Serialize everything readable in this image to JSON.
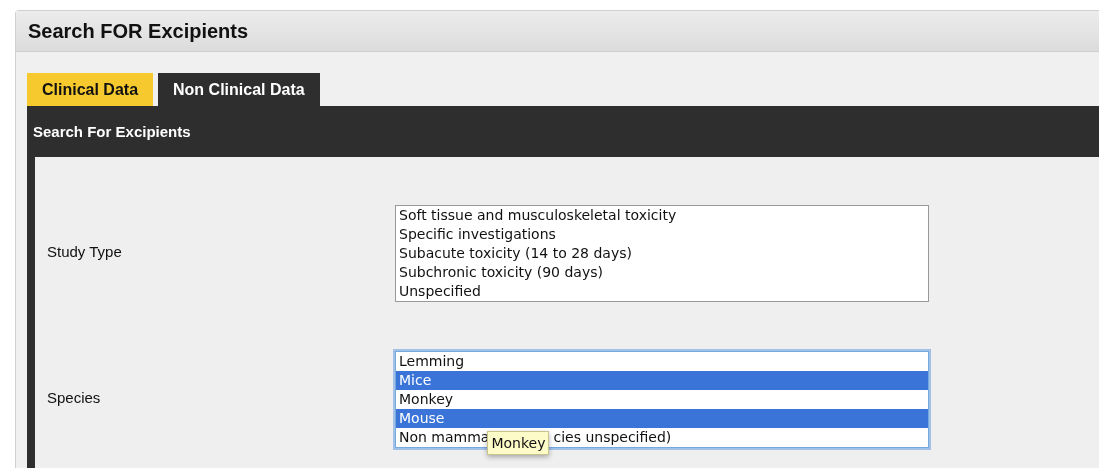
{
  "page_title": "Search FOR Excipients",
  "tabs": [
    {
      "label": "Clinical Data",
      "selected": false
    },
    {
      "label": "Non Clinical Data",
      "selected": true
    }
  ],
  "section_title": "Search For Excipients",
  "fields": [
    {
      "label": "Study Type",
      "focused": false,
      "options": [
        {
          "label": "Soft tissue and musculoskeletal toxicity",
          "selected": false
        },
        {
          "label": "Specific investigations",
          "selected": false
        },
        {
          "label": "Subacute toxicity (14 to 28 days)",
          "selected": false
        },
        {
          "label": "Subchronic toxicity (90 days)",
          "selected": false
        },
        {
          "label": "Unspecified",
          "selected": false
        }
      ]
    },
    {
      "label": "Species",
      "focused": true,
      "options": [
        {
          "label": "Lemming",
          "selected": false
        },
        {
          "label": "Mice",
          "selected": true
        },
        {
          "label": "Monkey",
          "selected": false
        },
        {
          "label": "Mouse",
          "selected": true
        },
        {
          "label": "Non mamma",
          "label_after_tooltip": "cies unspecified)",
          "selected": false
        }
      ],
      "tooltip": "Monkey"
    }
  ]
}
